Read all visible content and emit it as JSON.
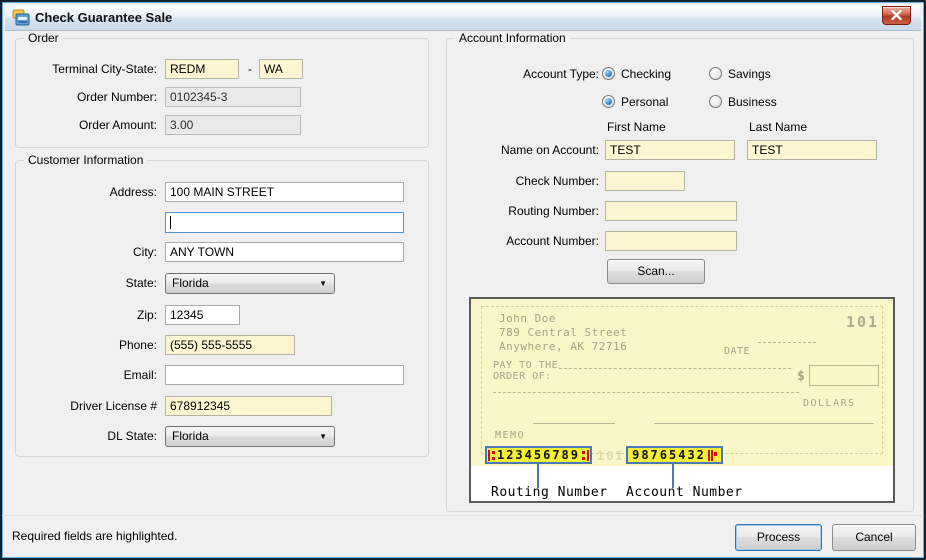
{
  "window": {
    "title": "Check Guarantee Sale"
  },
  "order": {
    "legend": "Order",
    "terminal_label": "Terminal City-State:",
    "terminal_city": "REDM",
    "terminal_sep": "-",
    "terminal_state": "WA",
    "order_number_label": "Order Number:",
    "order_number": "0102345-3",
    "order_amount_label": "Order Amount:",
    "order_amount": "3.00"
  },
  "customer": {
    "legend": "Customer Information",
    "address_label": "Address:",
    "address1": "100 MAIN STREET",
    "address2": "",
    "city_label": "City:",
    "city": "ANY TOWN",
    "state_label": "State:",
    "state": "Florida",
    "zip_label": "Zip:",
    "zip": "12345",
    "phone_label": "Phone:",
    "phone": "(555) 555-5555",
    "email_label": "Email:",
    "email": "",
    "dl_label": "Driver License #",
    "dl_number": "678912345",
    "dl_state_label": "DL State:",
    "dl_state": "Florida"
  },
  "account": {
    "legend": "Account Information",
    "type_label": "Account Type:",
    "radios": [
      {
        "label": "Checking",
        "checked": true
      },
      {
        "label": "Savings",
        "checked": false
      },
      {
        "label": "Personal",
        "checked": true
      },
      {
        "label": "Business",
        "checked": false
      }
    ],
    "first_name_label": "First Name",
    "last_name_label": "Last Name",
    "name_label": "Name on Account:",
    "first_name": "TEST",
    "last_name": "TEST",
    "check_number_label": "Check Number:",
    "check_number": "",
    "routing_label": "Routing Number:",
    "routing_number": "",
    "account_label": "Account Number:",
    "account_number": "",
    "scan_label": "Scan..."
  },
  "check_sample": {
    "name": "John Doe",
    "street": "789 Central Street",
    "city_line": "Anywhere, AK 72716",
    "check_no": "101",
    "date_label": "DATE",
    "payto_line1": "PAY TO THE",
    "payto_line2": "ORDER OF:",
    "dollar_sign": "$",
    "dollars_label": "DOLLARS",
    "memo_label": "MEMO",
    "micr_routing": "123456789",
    "micr_check_no": "101",
    "micr_account": "98765432",
    "routing_caption": "Routing Number",
    "account_caption": "Account Number"
  },
  "footer": {
    "note": "Required fields are highlighted.",
    "process_label": "Process",
    "cancel_label": "Cancel"
  },
  "colors": {
    "required_field_bg": "#fcf7d2",
    "readonly_field_bg": "#e9e9e9",
    "check_paper": "#f9f7c7",
    "micr_highlight": "#f2ee3a",
    "micr_symbol_red": "#cc1100",
    "pointer_blue": "#4a7ab5",
    "close_button_red": "#b23a27",
    "titlebar_top": "#fdfeff",
    "titlebar_bottom": "#c9d9ea"
  }
}
